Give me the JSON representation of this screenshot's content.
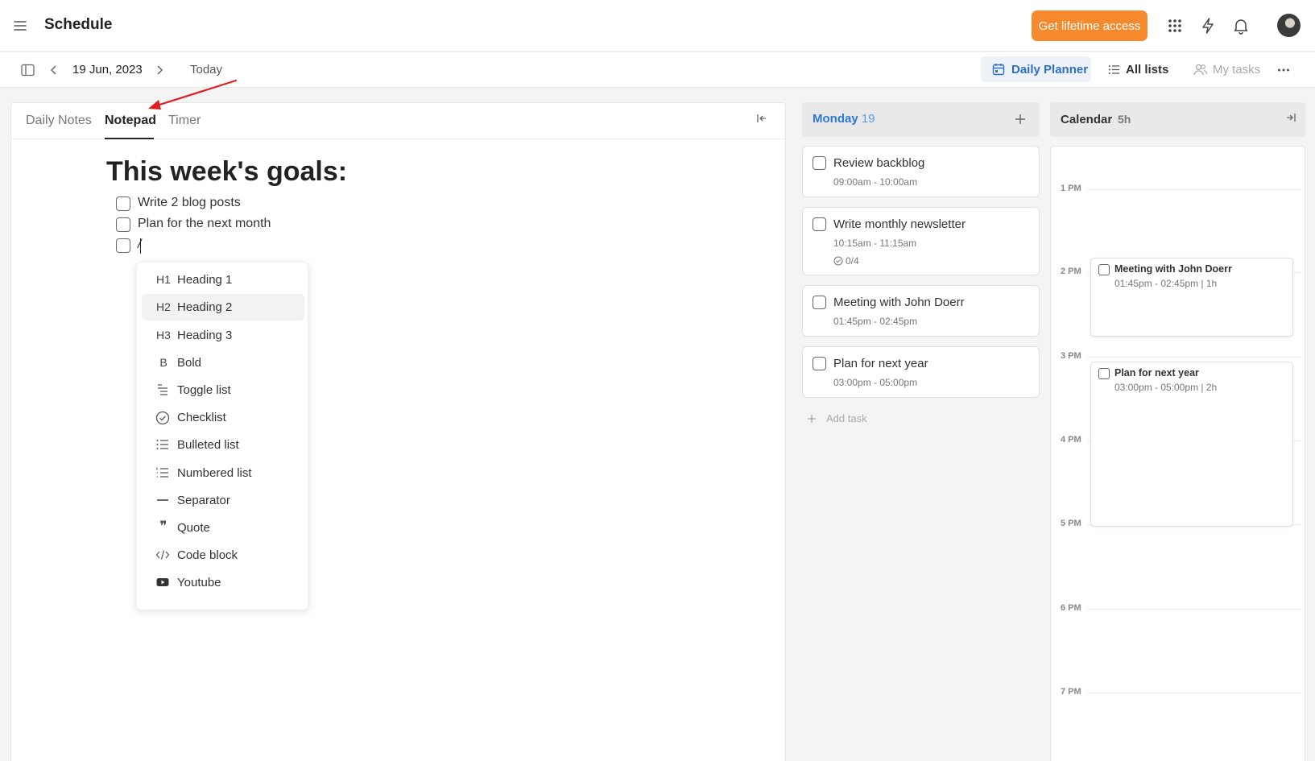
{
  "header": {
    "title": "Schedule",
    "cta_label": "Get lifetime access",
    "icons": [
      "menu-icon",
      "apps-grid-icon",
      "lightning-icon",
      "bell-icon",
      "avatar"
    ]
  },
  "toolbar": {
    "date": "19 Jun, 2023",
    "today_label": "Today",
    "views": [
      {
        "label": "Daily Planner",
        "icon": "calendar-icon",
        "active": true
      },
      {
        "label": "All lists",
        "icon": "list-icon",
        "active": false
      },
      {
        "label": "My tasks",
        "icon": "users-icon",
        "active": false,
        "disabled": true
      }
    ]
  },
  "notepad": {
    "tabs": [
      "Daily Notes",
      "Notepad",
      "Timer"
    ],
    "active_tab": "Notepad",
    "heading": "This week's goals:",
    "checklist": [
      {
        "text": "Write 2 blog posts",
        "checked": false
      },
      {
        "text": "Plan for the next month",
        "checked": false
      },
      {
        "text": "/",
        "checked": false
      }
    ],
    "slash_menu": [
      {
        "icon": "H1",
        "label": "Heading 1"
      },
      {
        "icon": "H2",
        "label": "Heading 2",
        "hover": true
      },
      {
        "icon": "H3",
        "label": "Heading 3"
      },
      {
        "icon": "B",
        "label": "Bold"
      },
      {
        "icon": "toggle-list-icon",
        "label": "Toggle list"
      },
      {
        "icon": "check-circle-icon",
        "label": "Checklist"
      },
      {
        "icon": "bulleted-list-icon",
        "label": "Bulleted list"
      },
      {
        "icon": "numbered-list-icon",
        "label": "Numbered list"
      },
      {
        "icon": "separator-icon",
        "label": "Separator"
      },
      {
        "icon": "quote-icon",
        "label": "Quote"
      },
      {
        "icon": "code-icon",
        "label": "Code block"
      },
      {
        "icon": "youtube-icon",
        "label": "Youtube"
      }
    ]
  },
  "day": {
    "name": "Monday",
    "number": "19",
    "tasks": [
      {
        "name": "Review backblog",
        "time": "09:00am - 10:00am"
      },
      {
        "name": "Write monthly newsletter",
        "time": "10:15am - 11:15am",
        "subtasks": "0/4"
      },
      {
        "name": "Meeting with John Doerr",
        "time": "01:45pm - 02:45pm"
      },
      {
        "name": "Plan for next year",
        "time": "03:00pm - 05:00pm"
      }
    ],
    "add_task_label": "Add task"
  },
  "calendar": {
    "title": "Calendar",
    "total_hours": "5h",
    "hours": [
      "1 PM",
      "2 PM",
      "3 PM",
      "4 PM",
      "5 PM",
      "6 PM",
      "7 PM"
    ],
    "events": [
      {
        "name": "Meeting with John Doerr",
        "time": "01:45pm - 02:45pm | 1h"
      },
      {
        "name": "Plan for next year",
        "time": "03:00pm - 05:00pm | 2h"
      }
    ]
  },
  "colors": {
    "accent": "#2c79d4",
    "cta": "#f5892b",
    "annotation_arrow": "#e02020"
  }
}
